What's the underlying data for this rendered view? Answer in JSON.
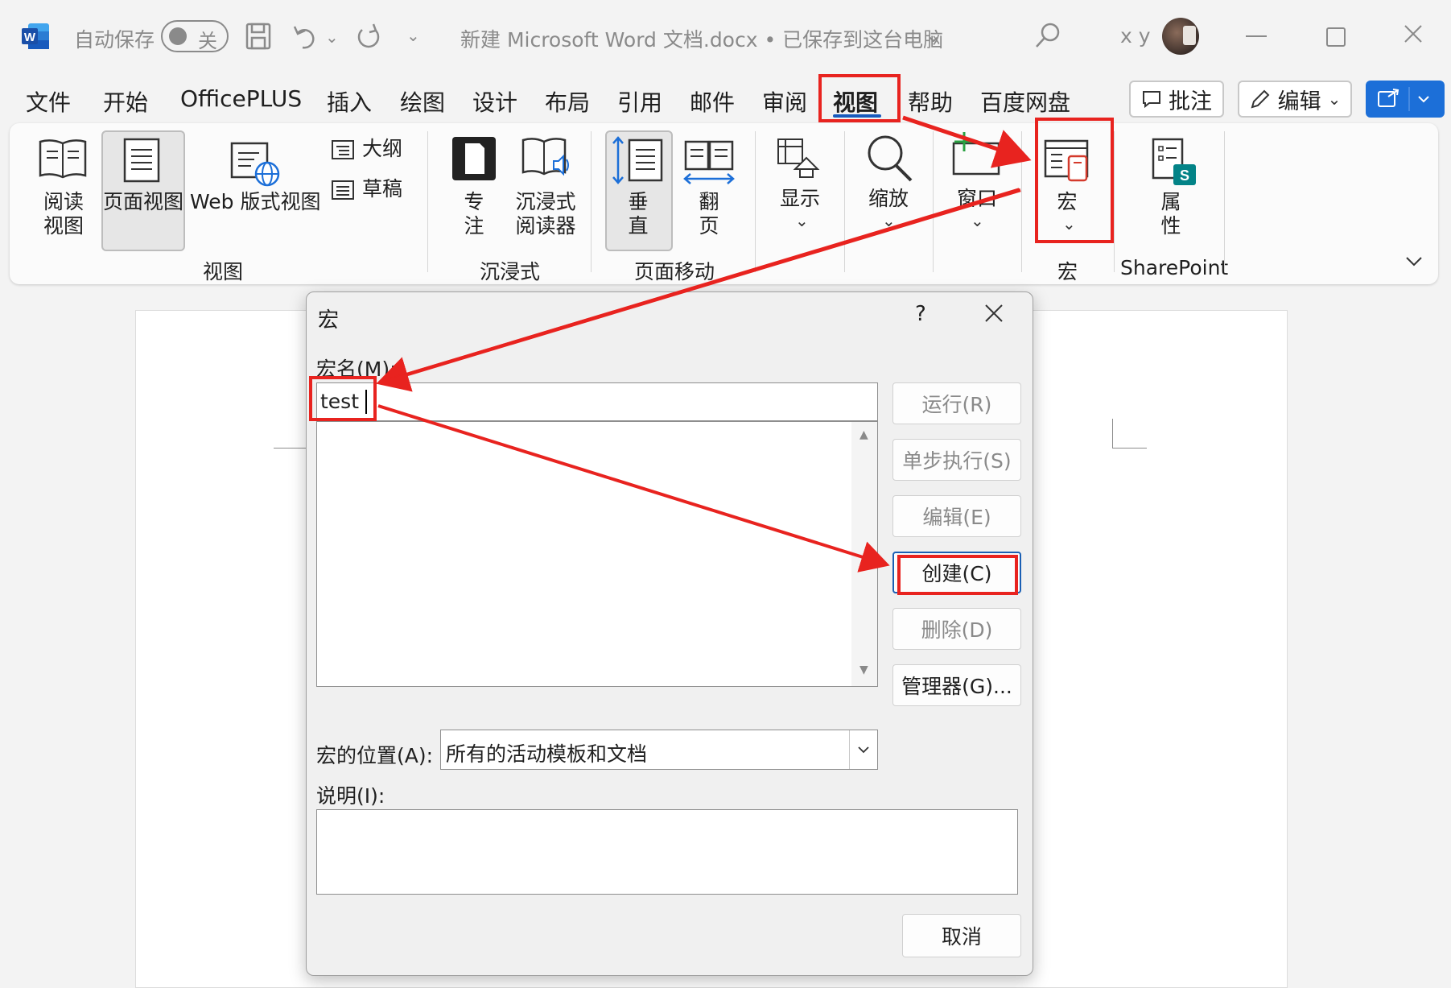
{
  "titlebar": {
    "autosave_label": "自动保存",
    "autosave_state": "关",
    "doc_title": "新建 Microsoft Word 文档.docx • 已保存到这台电脑",
    "user_initials": "x y"
  },
  "menu": {
    "items": [
      "文件",
      "开始",
      "OfficePLUS",
      "插入",
      "绘图",
      "设计",
      "布局",
      "引用",
      "邮件",
      "审阅",
      "视图",
      "帮助",
      "百度网盘"
    ],
    "active": "视图",
    "comment_btn": "批注",
    "edit_btn": "编辑"
  },
  "ribbon": {
    "views": {
      "read_mode": [
        "阅读",
        "视图"
      ],
      "print_layout": "页面视图",
      "web_layout": "Web 版式视图",
      "outline": "大纲",
      "draft": "草稿",
      "group": "视图"
    },
    "immersive": {
      "focus": [
        "专",
        "注"
      ],
      "reader": [
        "沉浸式",
        "阅读器"
      ],
      "group": "沉浸式"
    },
    "page_movement": {
      "vertical": [
        "垂",
        "直"
      ],
      "side_to_side": [
        "翻",
        "页"
      ],
      "group": "页面移动"
    },
    "show": "显示",
    "zoom": "缩放",
    "window": "窗口",
    "macros": {
      "label": "宏",
      "group": "宏"
    },
    "properties": {
      "label": [
        "属",
        "性"
      ],
      "group": "SharePoint"
    }
  },
  "dialog": {
    "title": "宏",
    "help": "?",
    "macro_name_label": "宏名(M):",
    "macro_name_value": "test",
    "buttons": {
      "run": "运行(R)",
      "step": "单步执行(S)",
      "edit": "编辑(E)",
      "create": "创建(C)",
      "delete": "删除(D)",
      "organizer": "管理器(G)...",
      "cancel": "取消"
    },
    "macros_in_label": "宏的位置(A):",
    "macros_in_value": "所有的活动模板和文档",
    "description_label": "说明(I):",
    "description_value": ""
  },
  "colors": {
    "accent": "#185abd",
    "annotation_red": "#e8231f",
    "share_button": "#1c6fd8"
  }
}
